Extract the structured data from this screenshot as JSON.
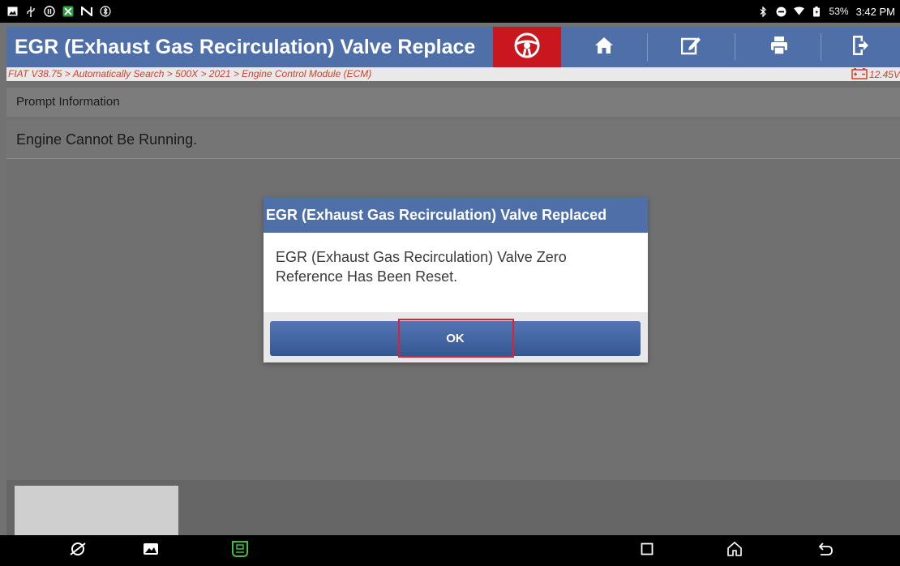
{
  "status_bar": {
    "battery_percent": "53%",
    "time": "3:42 PM",
    "left_icons": [
      "gallery-icon",
      "usb-icon",
      "pause-circle-icon",
      "app-icon",
      "n-icon",
      "bluetooth-settings-icon"
    ],
    "right_icons": [
      "bluetooth-icon",
      "do-not-disturb-icon",
      "wifi-icon",
      "battery-icon"
    ]
  },
  "header": {
    "title": "EGR (Exhaust Gas Recirculation) Valve Replace",
    "buttons": [
      "steering-wheel-icon",
      "home-icon",
      "edit-icon",
      "print-icon",
      "exit-icon"
    ],
    "accent_color": "#4f6fa8",
    "alert_color": "#c9161f"
  },
  "breadcrumb": {
    "path": "FIAT V38.75 > Automatically Search > 500X > 2021 > Engine Control Module (ECM)",
    "voltage": "12.45V",
    "color": "#d3412b"
  },
  "content": {
    "prompt_header": "Prompt Information",
    "message": "Engine Cannot Be Running."
  },
  "dialog": {
    "title": "EGR (Exhaust Gas Recirculation) Valve Replaced",
    "body_line1": "EGR (Exhaust Gas Recirculation) Valve Zero",
    "body_line2": "Reference Has Been Reset.",
    "ok_label": "OK",
    "highlight_color": "#e0202c"
  },
  "nav_bar": {
    "icons": [
      "browser-icon",
      "gallery-icon",
      "vci-icon",
      "recents-icon",
      "home-icon",
      "back-icon"
    ]
  }
}
